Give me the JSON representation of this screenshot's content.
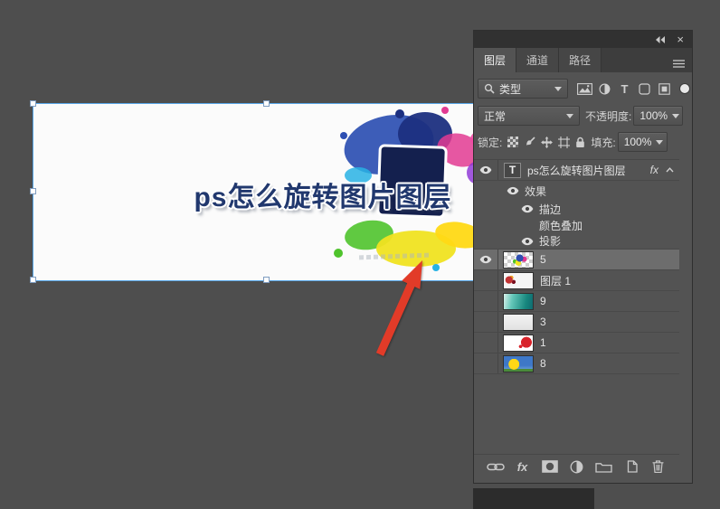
{
  "colors": {
    "app_background": "#4e4e4e",
    "panel_background": "#535353",
    "selected_row": "#6d6d6d",
    "selection_border": "#58a6e8",
    "arrow_red": "#e23b28"
  },
  "icons": {
    "type_glyph": "T",
    "fx_glyph": "fx",
    "close_glyph": "×"
  },
  "panel": {
    "tabs": [
      {
        "id": "tab-layers",
        "label": "图层",
        "active": true
      },
      {
        "id": "tab-channels",
        "label": "通道",
        "active": false
      },
      {
        "id": "tab-paths",
        "label": "路径",
        "active": false
      }
    ],
    "filter": {
      "kind_label": "类型",
      "icons": [
        "pixel-layers-filter-icon",
        "adjustment-layers-filter-icon",
        "type-layers-filter-icon",
        "shape-layers-filter-icon",
        "smart-object-filter-icon"
      ]
    },
    "blend": {
      "mode": "正常",
      "opacity_label": "不透明度:",
      "opacity_value": "100%"
    },
    "lock": {
      "label": "锁定:",
      "icons": [
        "lock-transparency-icon",
        "lock-pixels-icon",
        "lock-position-icon",
        "lock-artboard-icon",
        "lock-all-icon"
      ],
      "fill_label": "填充:",
      "fill_value": "100%"
    },
    "layers": [
      {
        "kind": "type",
        "name": "ps怎么旋转图片图层",
        "eye": true,
        "fx_badge": true
      },
      {
        "kind": "fxg",
        "name": "效果",
        "eye": true
      },
      {
        "kind": "fx",
        "name": "描边",
        "eye": true
      },
      {
        "kind": "fx",
        "name": "颜色叠加",
        "eye": false
      },
      {
        "kind": "fx",
        "name": "投影",
        "eye": true,
        "last": true
      },
      {
        "kind": "layer",
        "name": "5",
        "eye": true,
        "selected": true,
        "thumb": "splash"
      },
      {
        "kind": "layer",
        "name": "图层 1",
        "eye": false,
        "thumb": "whitered"
      },
      {
        "kind": "layer",
        "name": "9",
        "eye": false,
        "thumb": "teal"
      },
      {
        "kind": "layer",
        "name": "3",
        "eye": false,
        "thumb": "light"
      },
      {
        "kind": "layer",
        "name": "1",
        "eye": false,
        "thumb": "whitesplash"
      },
      {
        "kind": "layer",
        "name": "8",
        "eye": false,
        "thumb": "blueyellow"
      }
    ],
    "tools": [
      "link-layers-icon",
      "layer-style-icon",
      "add-layer-mask-icon",
      "new-adjustment-layer-icon",
      "new-group-icon",
      "new-layer-icon",
      "delete-layer-icon"
    ]
  },
  "canvas": {
    "title_text": "ps怎么旋转图片图层"
  }
}
